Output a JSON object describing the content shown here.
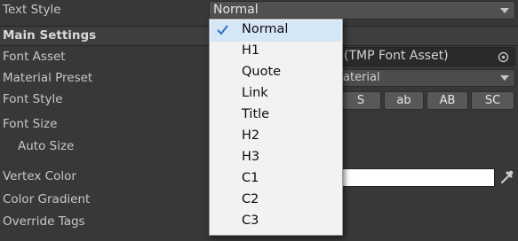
{
  "text_style": {
    "label": "Text Style",
    "value": "Normal"
  },
  "main_settings": {
    "header": "Main Settings",
    "font_asset": {
      "label": "Font Asset",
      "value": "(TMP Font Asset)"
    },
    "material_preset": {
      "label": "Material Preset",
      "value": "aterial"
    },
    "font_style": {
      "label": "Font Style",
      "buttons": [
        "S",
        "ab",
        "AB",
        "SC"
      ]
    },
    "font_size": {
      "label": "Font Size"
    },
    "auto_size": {
      "label": "Auto Size"
    },
    "vertex_color": {
      "label": "Vertex Color",
      "color": "#ffffff"
    },
    "color_gradient": {
      "label": "Color Gradient"
    },
    "override_tags": {
      "label": "Override Tags"
    }
  },
  "style_dropdown": {
    "selected": "Normal",
    "items": [
      "Normal",
      "H1",
      "Quote",
      "Link",
      "Title",
      "H2",
      "H3",
      "C1",
      "C2",
      "C3"
    ]
  },
  "colors": {
    "panel_bg": "#383838",
    "field_bg": "#2a2a2a",
    "menu_bg": "#f2f2f2",
    "menu_highlight": "#d5e6f7",
    "check": "#2f6fc4"
  }
}
